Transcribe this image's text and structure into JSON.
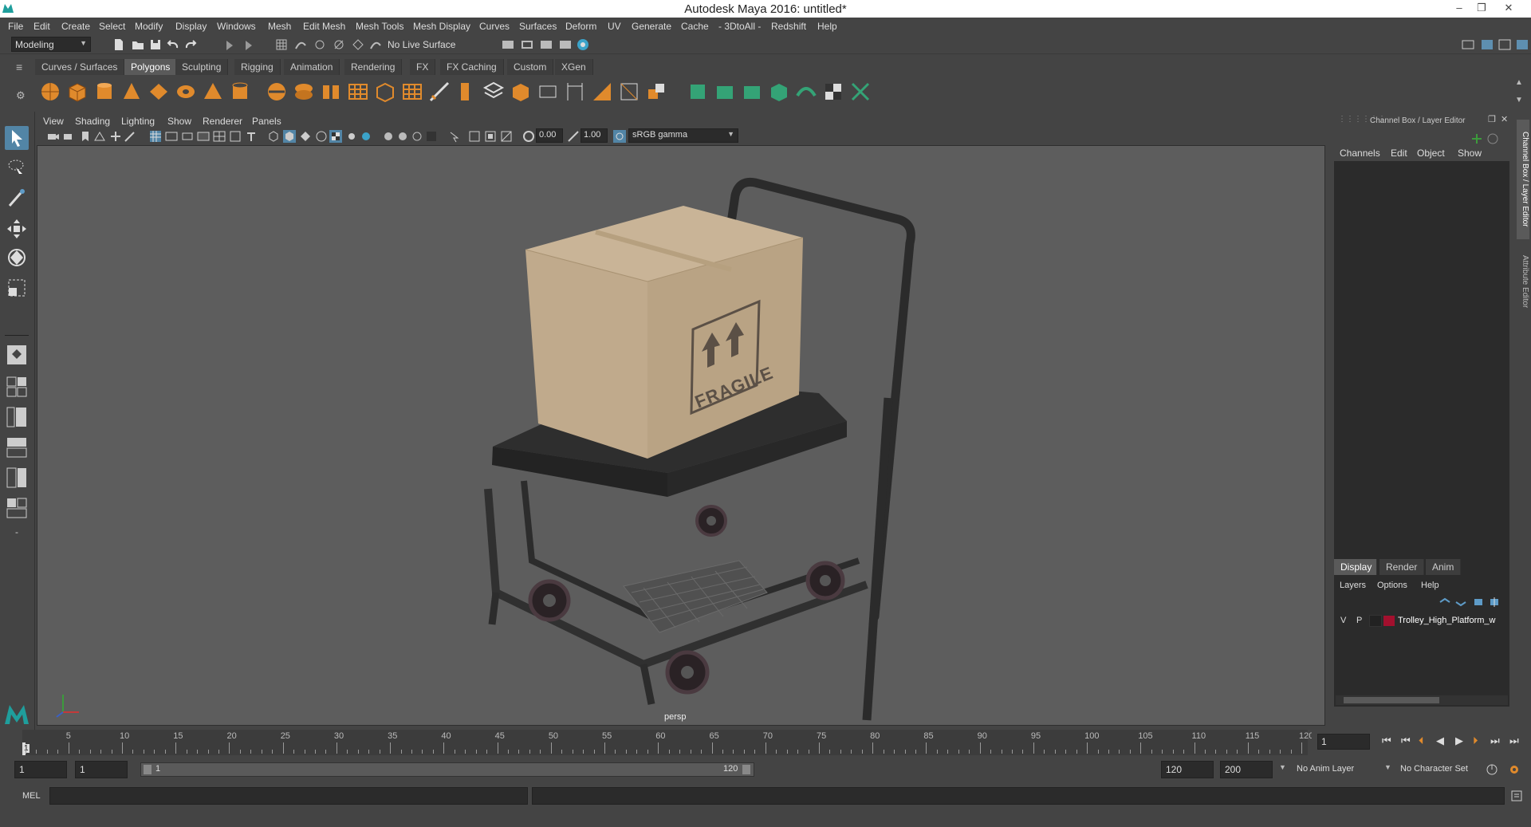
{
  "window": {
    "title": "Autodesk Maya 2016: untitled*",
    "minimize": "–",
    "restore": "❐",
    "close": "✕"
  },
  "menubar": [
    "File",
    "Edit",
    "Create",
    "Select",
    "Modify",
    "Display",
    "Windows",
    "Mesh",
    "Edit Mesh",
    "Mesh Tools",
    "Mesh Display",
    "Curves",
    "Surfaces",
    "Deform",
    "UV",
    "Generate",
    "Cache",
    "- 3DtoAll -",
    "Redshift",
    "Help"
  ],
  "status": {
    "mode": "Modeling",
    "live_surface": "No Live Surface"
  },
  "shelf_tabs": [
    "Curves / Surfaces",
    "Polygons",
    "Sculpting",
    "Rigging",
    "Animation",
    "Rendering",
    "FX",
    "FX Caching",
    "Custom",
    "XGen"
  ],
  "shelf_active": "Polygons",
  "viewport": {
    "menus": [
      "View",
      "Shading",
      "Lighting",
      "Show",
      "Renderer",
      "Panels"
    ],
    "exposure": "0.00",
    "gamma": "1.00",
    "color_space": "sRGB gamma",
    "camera_label": "persp",
    "box_label": "FRAGILE"
  },
  "channel_box": {
    "title": "Channel Box / Layer Editor",
    "menus": [
      "Channels",
      "Edit",
      "Object",
      "Show"
    ]
  },
  "layer_editor": {
    "tabs": [
      "Display",
      "Render",
      "Anim"
    ],
    "active_tab": "Display",
    "menus": [
      "Layers",
      "Options",
      "Help"
    ],
    "layers": [
      {
        "v": "V",
        "p": "P",
        "color": "#a3102e",
        "name": "Trolley_High_Platform_w"
      }
    ]
  },
  "side_tabs": [
    "Channel Box / Layer Editor",
    "Attribute Editor"
  ],
  "timeline": {
    "labels": [
      "5",
      "10",
      "15",
      "20",
      "25",
      "30",
      "35",
      "40",
      "45",
      "50",
      "55",
      "60",
      "65",
      "70",
      "75",
      "80",
      "85",
      "90",
      "95",
      "100",
      "105",
      "110",
      "115",
      "120"
    ],
    "current_frame_marker": "1",
    "current_frame_field": "1"
  },
  "range": {
    "start": "1",
    "playback_start": "1",
    "slider_start": "1",
    "slider_end": "120",
    "playback_end": "120",
    "end": "200",
    "anim_layer": "No Anim Layer",
    "character_set": "No Character Set"
  },
  "command": {
    "label": "MEL"
  }
}
